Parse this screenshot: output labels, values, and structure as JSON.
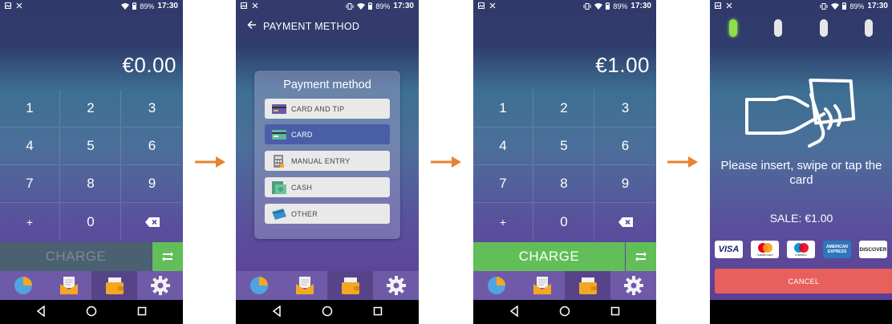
{
  "status": {
    "battery": "89%",
    "time": "17:30"
  },
  "screen1": {
    "amount": "€0.00",
    "keys": [
      "1",
      "2",
      "3",
      "4",
      "5",
      "6",
      "7",
      "8",
      "9",
      "+",
      "0"
    ],
    "charge_label": "CHARGE"
  },
  "screen2": {
    "appbar_title": "PAYMENT METHOD",
    "dialog_title": "Payment method",
    "methods": [
      {
        "label": "CARD AND TIP",
        "icon": "card-tip-icon"
      },
      {
        "label": "CARD",
        "icon": "card-icon",
        "selected": true
      },
      {
        "label": "MANUAL ENTRY",
        "icon": "calculator-icon"
      },
      {
        "label": "CASH",
        "icon": "cash-icon"
      },
      {
        "label": "OTHER",
        "icon": "other-payment-icon"
      }
    ]
  },
  "screen3": {
    "amount": "€1.00",
    "keys": [
      "1",
      "2",
      "3",
      "4",
      "5",
      "6",
      "7",
      "8",
      "9",
      "+",
      "0"
    ],
    "charge_label": "CHARGE"
  },
  "screen4": {
    "prompt": "Please insert, swipe or tap the card",
    "sale": "SALE: €1.00",
    "brands": [
      "VISA",
      "mastercard",
      "maestro",
      "AMERICAN EXPRESS",
      "DISCOVER"
    ],
    "cancel_label": "CANCEL"
  },
  "tabs": [
    "reports-icon",
    "mail-icon",
    "wallet-icon",
    "gear-icon"
  ],
  "colors": {
    "charge_active": "#61be58",
    "charge_inactive": "#4b6070",
    "cancel": "#e8605c",
    "selected_method": "#4a5ea8",
    "arrow": "#e8822e",
    "led_on": "#8ee04a"
  }
}
